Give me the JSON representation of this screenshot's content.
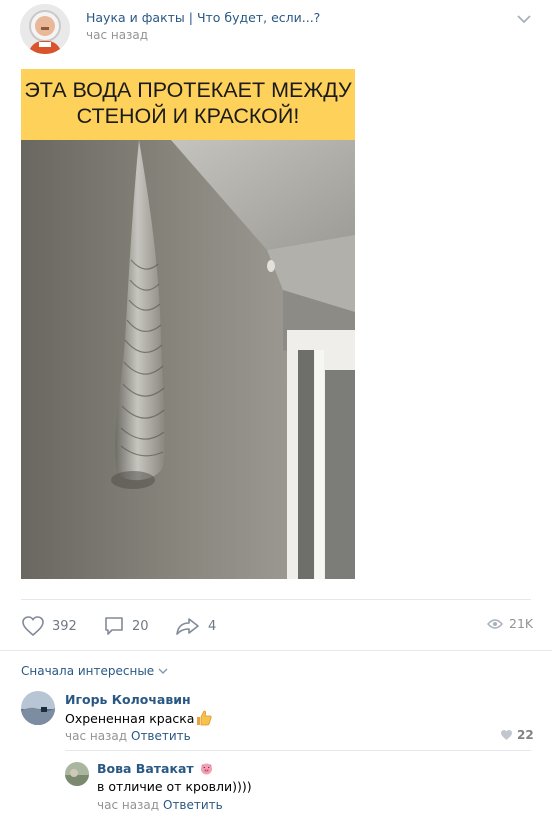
{
  "post": {
    "group_name": "Наука и факты | Что будет, если...?",
    "time": "час назад",
    "banner_text": "ЭТА ВОДА ПРОТЕКАЕТ МЕЖДУ СТЕНОЙ И КРАСКОЙ!",
    "colors": {
      "banner": "#fdd15a",
      "link": "#2a5885",
      "muted": "#939393"
    }
  },
  "actions": {
    "likes": "392",
    "comments": "20",
    "shares": "4",
    "views": "21K"
  },
  "comments_section": {
    "sort_label": "Сначала интересные",
    "comments": [
      {
        "author": "Игорь Колочавин",
        "text": "Охрененная краска",
        "emoji": "thumbs-up",
        "time": "час назад",
        "reply_label": "Ответить",
        "likes": "22"
      },
      {
        "author": "Вова Ватакат",
        "emoji": "pig-face",
        "text": "в отличие от кровли))))",
        "time": "час назад",
        "reply_label": "Ответить"
      }
    ]
  }
}
